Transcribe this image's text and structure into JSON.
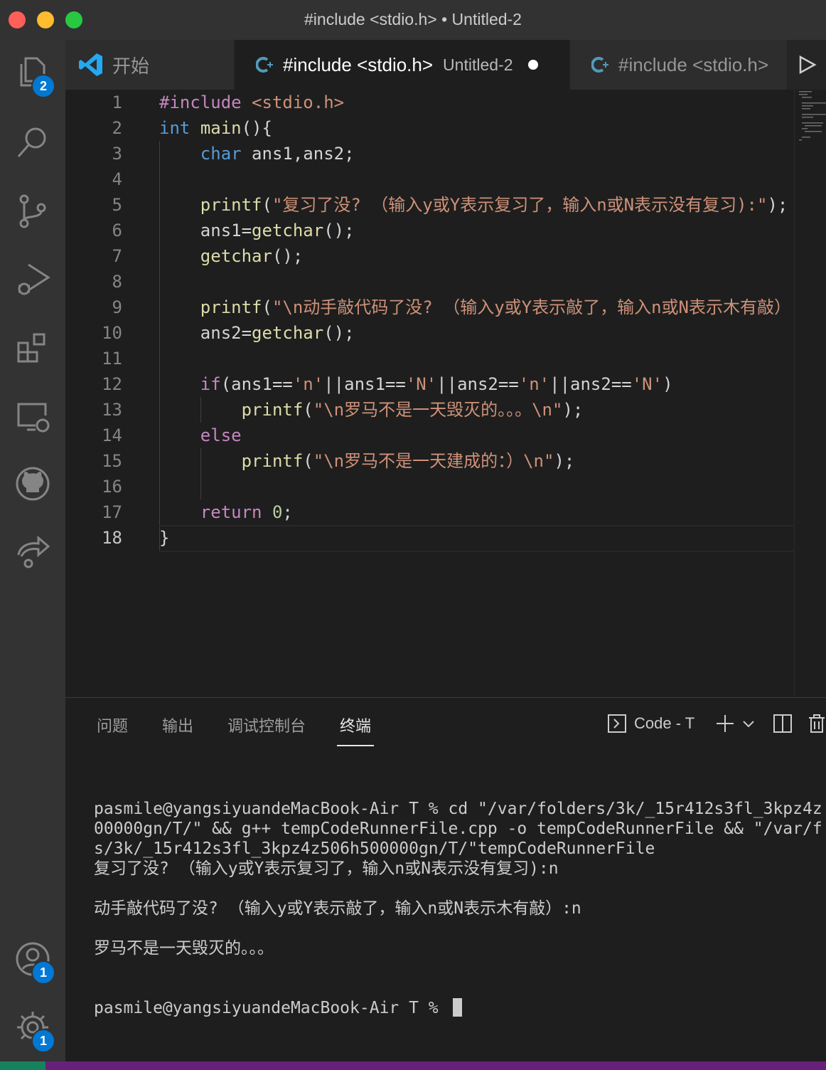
{
  "window": {
    "title": "#include <stdio.h> • Untitled-2"
  },
  "activity_bar": {
    "explorer_badge": "2",
    "accounts_badge": "1",
    "settings_badge": "1"
  },
  "tabs": [
    {
      "label": "开始",
      "subtitle": "",
      "icon": "vscode-logo-icon"
    },
    {
      "label": "#include <stdio.h>",
      "subtitle": "Untitled-2",
      "icon": "cpp-file-icon",
      "dirty": true
    },
    {
      "label": "#include <stdio.h>",
      "subtitle": "",
      "icon": "cpp-file-icon"
    }
  ],
  "editor": {
    "current_line": 18,
    "lines": [
      {
        "n": "1",
        "t": [
          [
            "ctl",
            "#include"
          ],
          [
            "plain",
            " "
          ],
          [
            "str",
            "<stdio.h>"
          ]
        ]
      },
      {
        "n": "2",
        "t": [
          [
            "kw",
            "int"
          ],
          [
            "plain",
            " "
          ],
          [
            "fn",
            "main"
          ],
          [
            "plain",
            "(){"
          ]
        ]
      },
      {
        "n": "3",
        "t": [
          [
            "plain",
            "    "
          ],
          [
            "kw",
            "char"
          ],
          [
            "plain",
            " ans1,ans2;"
          ]
        ]
      },
      {
        "n": "4",
        "t": []
      },
      {
        "n": "5",
        "t": [
          [
            "plain",
            "    "
          ],
          [
            "fn",
            "printf"
          ],
          [
            "plain",
            "("
          ],
          [
            "str",
            "\"复习了没? （输入y或Y表示复习了，输入n或N表示没有复习):\""
          ],
          [
            "plain",
            ");"
          ]
        ]
      },
      {
        "n": "6",
        "t": [
          [
            "plain",
            "    ans1="
          ],
          [
            "fn",
            "getchar"
          ],
          [
            "plain",
            "();"
          ]
        ]
      },
      {
        "n": "7",
        "t": [
          [
            "plain",
            "    "
          ],
          [
            "fn",
            "getchar"
          ],
          [
            "plain",
            "();"
          ]
        ]
      },
      {
        "n": "8",
        "t": []
      },
      {
        "n": "9",
        "t": [
          [
            "plain",
            "    "
          ],
          [
            "fn",
            "printf"
          ],
          [
            "plain",
            "("
          ],
          [
            "str",
            "\"\\n动手敲代码了没? （输入y或Y表示敲了，输入n或N表示木有敲）:"
          ]
        ]
      },
      {
        "n": "10",
        "t": [
          [
            "plain",
            "    ans2="
          ],
          [
            "fn",
            "getchar"
          ],
          [
            "plain",
            "();"
          ]
        ]
      },
      {
        "n": "11",
        "t": []
      },
      {
        "n": "12",
        "t": [
          [
            "plain",
            "    "
          ],
          [
            "ctl",
            "if"
          ],
          [
            "plain",
            "(ans1=="
          ],
          [
            "str",
            "'n'"
          ],
          [
            "plain",
            "||ans1=="
          ],
          [
            "str",
            "'N'"
          ],
          [
            "plain",
            "||ans2=="
          ],
          [
            "str",
            "'n'"
          ],
          [
            "plain",
            "||ans2=="
          ],
          [
            "str",
            "'N'"
          ],
          [
            "plain",
            ")"
          ]
        ]
      },
      {
        "n": "13",
        "t": [
          [
            "plain",
            "        "
          ],
          [
            "fn",
            "printf"
          ],
          [
            "plain",
            "("
          ],
          [
            "str",
            "\"\\n罗马不是一天毁灭的。。。\\n\""
          ],
          [
            "plain",
            ");"
          ]
        ]
      },
      {
        "n": "14",
        "t": [
          [
            "plain",
            "    "
          ],
          [
            "ctl",
            "else"
          ]
        ]
      },
      {
        "n": "15",
        "t": [
          [
            "plain",
            "        "
          ],
          [
            "fn",
            "printf"
          ],
          [
            "plain",
            "("
          ],
          [
            "str",
            "\"\\n罗马不是一天建成的：）\\n\""
          ],
          [
            "plain",
            ");"
          ]
        ]
      },
      {
        "n": "16",
        "t": []
      },
      {
        "n": "17",
        "t": [
          [
            "plain",
            "    "
          ],
          [
            "ctl",
            "return"
          ],
          [
            "plain",
            " "
          ],
          [
            "num",
            "0"
          ],
          [
            "plain",
            ";"
          ]
        ]
      },
      {
        "n": "18",
        "t": [
          [
            "plain",
            "}"
          ]
        ]
      }
    ]
  },
  "panel": {
    "tabs": [
      "问题",
      "输出",
      "调试控制台",
      "终端"
    ],
    "active_tab": "终端",
    "terminal_name": "Code - T",
    "terminal_lines": [
      "pasmile@yangsiyuandeMacBook-Air T % cd \"/var/folders/3k/_15r412s3fl_3kpz4z",
      "00000gn/T/\" && g++ tempCodeRunnerFile.cpp -o tempCodeRunnerFile && \"/var/f",
      "s/3k/_15r412s3fl_3kpz4z506h500000gn/T/\"tempCodeRunnerFile",
      "复习了没? （输入y或Y表示复习了，输入n或N表示没有复习):n",
      "",
      "动手敲代码了没? （输入y或Y表示敲了，输入n或N表示木有敲）:n",
      "",
      "罗马不是一天毁灭的。。。"
    ],
    "prompt": "pasmile@yangsiyuandeMacBook-Air T % "
  }
}
